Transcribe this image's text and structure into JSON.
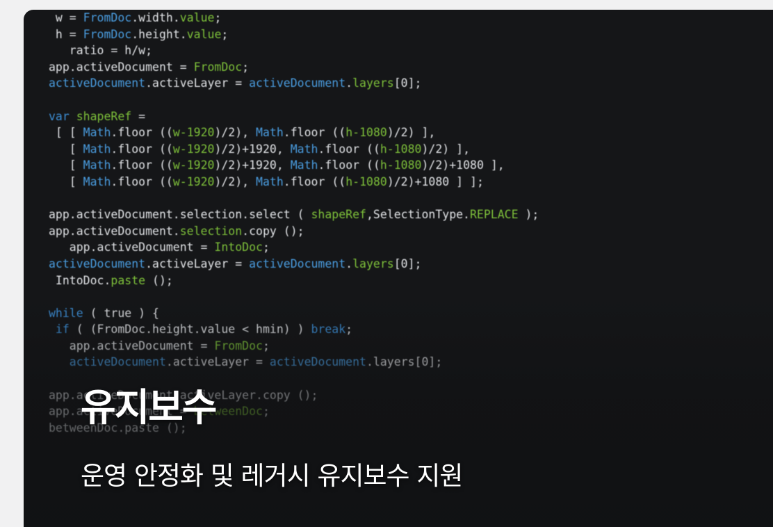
{
  "card": {
    "title": "유지보수",
    "subtitle": "운영 안정화 및 레거시 유지보수 지원"
  },
  "code_lines": [
    [
      {
        "t": " w = ",
        "c": "pl"
      },
      {
        "t": "FromDoc",
        "c": "obj"
      },
      {
        "t": ".width.",
        "c": "pl"
      },
      {
        "t": "value",
        "c": "fn"
      },
      {
        "t": ";",
        "c": "pl"
      }
    ],
    [
      {
        "t": " h = ",
        "c": "pl"
      },
      {
        "t": "FromDoc",
        "c": "obj"
      },
      {
        "t": ".height.",
        "c": "pl"
      },
      {
        "t": "value",
        "c": "fn"
      },
      {
        "t": ";",
        "c": "pl"
      }
    ],
    [
      {
        "t": "   ratio = h/w;",
        "c": "pl"
      }
    ],
    [
      {
        "t": "app.activeDocument = ",
        "c": "pl"
      },
      {
        "t": "FromDoc",
        "c": "fn"
      },
      {
        "t": ";",
        "c": "pl"
      }
    ],
    [
      {
        "t": "activeDocument",
        "c": "obj"
      },
      {
        "t": ".activeLayer = ",
        "c": "pl"
      },
      {
        "t": "activeDocument",
        "c": "obj"
      },
      {
        "t": ".",
        "c": "pl"
      },
      {
        "t": "layers",
        "c": "fn"
      },
      {
        "t": "[0];",
        "c": "pl"
      }
    ],
    [
      {
        "t": "",
        "c": "pl"
      }
    ],
    [
      {
        "t": "var ",
        "c": "kw"
      },
      {
        "t": "shapeRef",
        "c": "fn"
      },
      {
        "t": " =",
        "c": "pl"
      }
    ],
    [
      {
        "t": " [ [ ",
        "c": "pl"
      },
      {
        "t": "Math",
        "c": "obj"
      },
      {
        "t": ".floor ((",
        "c": "pl"
      },
      {
        "t": "w-1920",
        "c": "num"
      },
      {
        "t": ")/2), ",
        "c": "pl"
      },
      {
        "t": "Math",
        "c": "obj"
      },
      {
        "t": ".floor ((",
        "c": "pl"
      },
      {
        "t": "h-1080",
        "c": "num"
      },
      {
        "t": ")/2) ],",
        "c": "pl"
      }
    ],
    [
      {
        "t": "   [ ",
        "c": "pl"
      },
      {
        "t": "Math",
        "c": "obj"
      },
      {
        "t": ".floor ((",
        "c": "pl"
      },
      {
        "t": "w-1920",
        "c": "num"
      },
      {
        "t": ")/2)+1920, ",
        "c": "pl"
      },
      {
        "t": "Math",
        "c": "obj"
      },
      {
        "t": ".floor ((",
        "c": "pl"
      },
      {
        "t": "h-1080",
        "c": "num"
      },
      {
        "t": ")/2) ],",
        "c": "pl"
      }
    ],
    [
      {
        "t": "   [ ",
        "c": "pl"
      },
      {
        "t": "Math",
        "c": "obj"
      },
      {
        "t": ".floor ((",
        "c": "pl"
      },
      {
        "t": "w-1920",
        "c": "num"
      },
      {
        "t": ")/2)+1920, ",
        "c": "pl"
      },
      {
        "t": "Math",
        "c": "obj"
      },
      {
        "t": ".floor ((",
        "c": "pl"
      },
      {
        "t": "h-1080",
        "c": "num"
      },
      {
        "t": ")/2)+1080 ],",
        "c": "pl"
      }
    ],
    [
      {
        "t": "   [ ",
        "c": "pl"
      },
      {
        "t": "Math",
        "c": "obj"
      },
      {
        "t": ".floor ((",
        "c": "pl"
      },
      {
        "t": "w-1920",
        "c": "num"
      },
      {
        "t": ")/2), ",
        "c": "pl"
      },
      {
        "t": "Math",
        "c": "obj"
      },
      {
        "t": ".floor ((",
        "c": "pl"
      },
      {
        "t": "h-1080",
        "c": "num"
      },
      {
        "t": ")/2)+1080 ] ];",
        "c": "pl"
      }
    ],
    [
      {
        "t": "",
        "c": "pl"
      }
    ],
    [
      {
        "t": "app.activeDocument.selection.select ( ",
        "c": "pl"
      },
      {
        "t": "shapeRef",
        "c": "fn"
      },
      {
        "t": ",SelectionType.",
        "c": "pl"
      },
      {
        "t": "REPLACE",
        "c": "fn"
      },
      {
        "t": " );",
        "c": "pl"
      }
    ],
    [
      {
        "t": "app.activeDocument.",
        "c": "pl"
      },
      {
        "t": "selection",
        "c": "fn"
      },
      {
        "t": ".copy ();",
        "c": "pl"
      }
    ],
    [
      {
        "t": "   app.activeDocument = ",
        "c": "pl"
      },
      {
        "t": "IntoDoc",
        "c": "fn"
      },
      {
        "t": ";",
        "c": "pl"
      }
    ],
    [
      {
        "t": "activeDocument",
        "c": "obj"
      },
      {
        "t": ".activeLayer = ",
        "c": "pl"
      },
      {
        "t": "activeDocument",
        "c": "obj"
      },
      {
        "t": ".",
        "c": "pl"
      },
      {
        "t": "layers",
        "c": "fn"
      },
      {
        "t": "[0];",
        "c": "pl"
      }
    ],
    [
      {
        "t": " IntoDoc.",
        "c": "pl"
      },
      {
        "t": "paste",
        "c": "fn"
      },
      {
        "t": " ();",
        "c": "pl"
      }
    ],
    [
      {
        "t": "",
        "c": "pl"
      }
    ],
    [
      {
        "t": "while",
        "c": "kw"
      },
      {
        "t": " ( true ) {",
        "c": "pl"
      }
    ],
    [
      {
        "t": " if",
        "c": "kw"
      },
      {
        "t": " ( (FromDoc.height.value < hmin) ) ",
        "c": "pl"
      },
      {
        "t": "break",
        "c": "kw"
      },
      {
        "t": ";",
        "c": "pl"
      }
    ],
    [
      {
        "t": "   app.activeDocument = ",
        "c": "pl"
      },
      {
        "t": "FromDoc",
        "c": "fn"
      },
      {
        "t": ";",
        "c": "pl"
      }
    ],
    [
      {
        "t": "   activeDocument",
        "c": "obj"
      },
      {
        "t": ".activeLayer = ",
        "c": "pl"
      },
      {
        "t": "activeDocument",
        "c": "obj"
      },
      {
        "t": ".layers[0];",
        "c": "pl"
      }
    ],
    [
      {
        "t": "",
        "c": "pl"
      }
    ],
    [
      {
        "t": "app.activeDocument.activeLayer.copy ();",
        "c": "pl"
      }
    ],
    [
      {
        "t": "app.activeDocument = ",
        "c": "pl"
      },
      {
        "t": "betweenDoc",
        "c": "fn"
      },
      {
        "t": ";",
        "c": "pl"
      }
    ],
    [
      {
        "t": "betweenDoc.paste ();",
        "c": "pl"
      }
    ]
  ]
}
